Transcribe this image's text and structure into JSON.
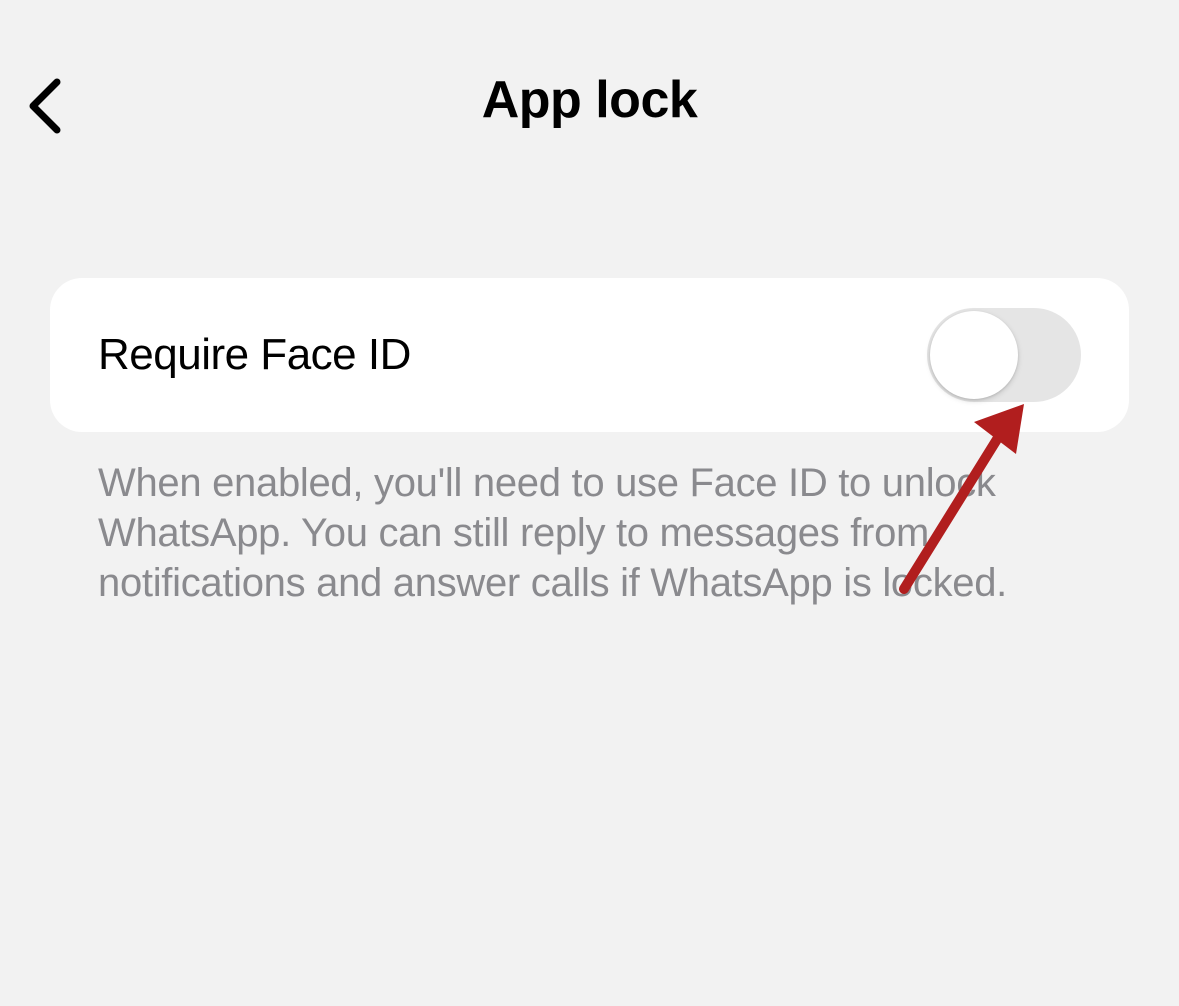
{
  "header": {
    "title": "App lock"
  },
  "settings": {
    "require_face_id": {
      "label": "Require Face ID",
      "enabled": false,
      "description": "When enabled, you'll need to use Face ID to unlock WhatsApp. You can still reply to messages from notifications and answer calls if WhatsApp is locked."
    }
  },
  "annotation": {
    "arrow_color": "#b11e1e"
  }
}
